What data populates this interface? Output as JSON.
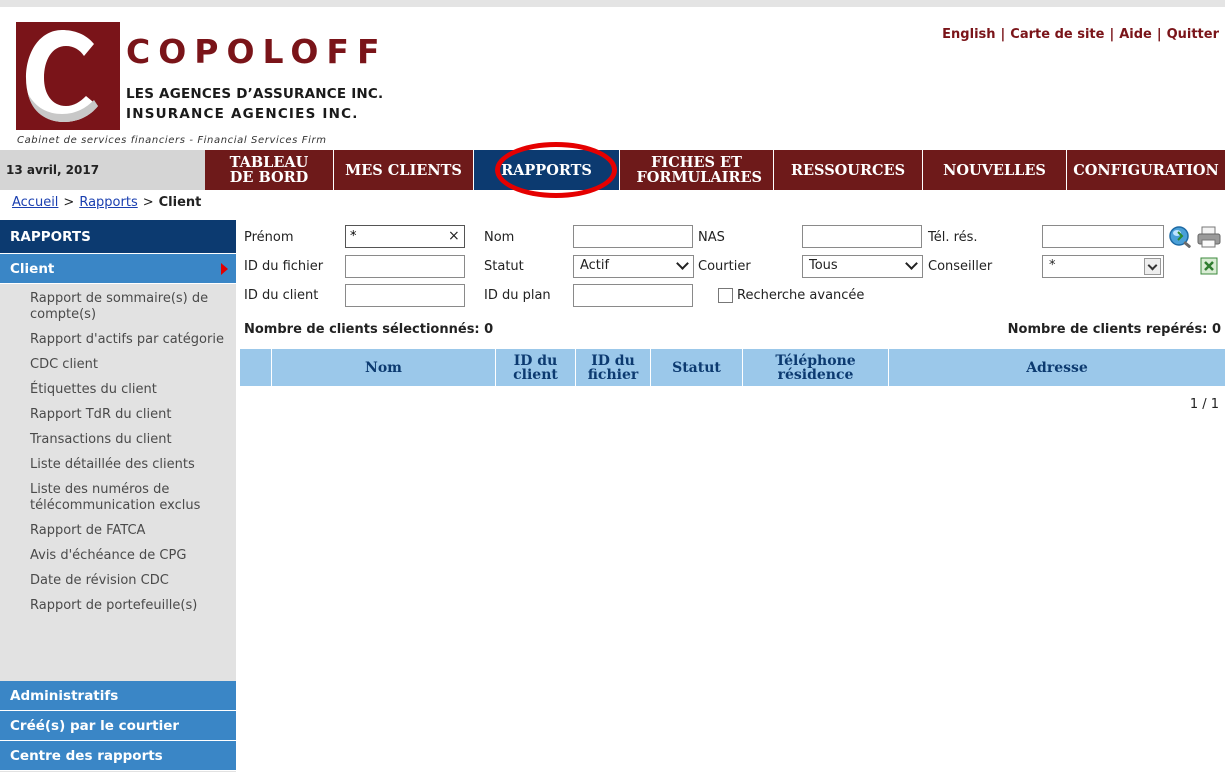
{
  "top_links": [
    "English",
    "Carte de site",
    "Aide",
    "Quitter"
  ],
  "logo": {
    "brand": "COPOLOFF",
    "line1": "LES AGENCES D’ASSURANCE INC.",
    "line2": "INSURANCE AGENCIES INC.",
    "tagline": "Cabinet de services financiers - Financial Services Firm",
    "color": "#7a1419"
  },
  "date": "13 avril, 2017",
  "nav": [
    {
      "label": "TABLEAU DE BORD",
      "active": false
    },
    {
      "label": "MES CLIENTS",
      "active": false
    },
    {
      "label": "RAPPORTS",
      "active": true
    },
    {
      "label": "FICHES ET FORMULAIRES",
      "active": false
    },
    {
      "label": "RESSOURCES",
      "active": false
    },
    {
      "label": "NOUVELLES",
      "active": false
    },
    {
      "label": "CONFIGURATION",
      "active": false
    }
  ],
  "breadcrumb": {
    "home": "Accueil",
    "section": "Rapports",
    "current": "Client",
    "sep": ">"
  },
  "sidebar": {
    "header": "RAPPORTS",
    "active_section": "Client",
    "items": [
      "Rapport de sommaire(s) de compte(s)",
      "Rapport d'actifs par catégorie",
      "CDC client",
      "Étiquettes du client",
      "Rapport TdR du client",
      "Transactions du client",
      "Liste détaillée des clients",
      "Liste des numéros de télécommunication exclus",
      "Rapport de FATCA",
      "Avis d'échéance de CPG",
      "Date de révision CDC",
      "Rapport de portefeuille(s)"
    ],
    "sections": [
      "Administratifs",
      "Créé(s) par le courtier",
      "Centre des rapports"
    ]
  },
  "form": {
    "prenom_label": "Prénom",
    "prenom_value": "*",
    "nom_label": "Nom",
    "nom_value": "",
    "nas_label": "NAS",
    "nas_value": "",
    "tel_label": "Tél. rés.",
    "tel_value": "",
    "fichier_label": "ID du fichier",
    "fichier_value": "",
    "statut_label": "Statut",
    "statut_value": "Actif",
    "courtier_label": "Courtier",
    "courtier_value": "Tous",
    "conseiller_label": "Conseiller",
    "conseiller_value": "*",
    "client_label": "ID du client",
    "client_value": "",
    "plan_label": "ID du plan",
    "plan_value": "",
    "advanced_label": "Recherche avancée"
  },
  "counts": {
    "selected": "Nombre de clients sélectionnés: 0",
    "found": "Nombre de clients repérés: 0"
  },
  "table": {
    "headers": [
      "Nom",
      "ID du client",
      "ID du fichier",
      "Statut",
      "Téléphone résidence",
      "Adresse"
    ],
    "rows": []
  },
  "pagination": "1 / 1",
  "colors": {
    "nav": "#6e1a1a",
    "nav_active": "#0c3a70",
    "sidebar_section": "#3a86c6",
    "table_header": "#9bc8ea",
    "highlight_circle": "#e50000"
  },
  "icons": [
    "search-icon",
    "print-icon",
    "excel-export-icon"
  ]
}
